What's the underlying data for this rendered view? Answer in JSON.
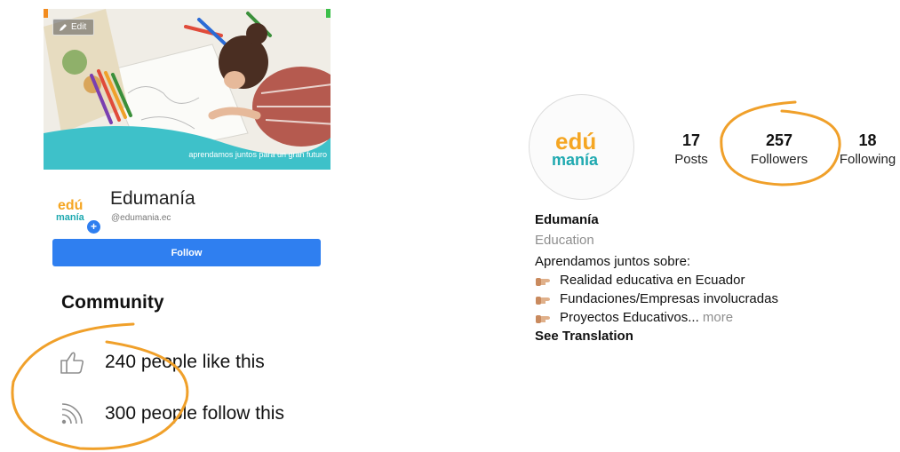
{
  "facebook": {
    "edit_label": "Edit",
    "cover_caption": "aprendamos juntos para un gran futuro",
    "page_name": "Edumanía",
    "handle": "@edumania.ec",
    "follow_label": "Follow",
    "community_title": "Community",
    "likes_text": "240 people like this",
    "follows_text": "300 people follow this"
  },
  "instagram": {
    "stats": [
      {
        "value": "17",
        "label": "Posts"
      },
      {
        "value": "257",
        "label": "Followers"
      },
      {
        "value": "18",
        "label": "Following"
      }
    ],
    "name": "Edumanía",
    "category": "Education",
    "bio_intro": "Aprendamos juntos sobre:",
    "bio_items": [
      "Realidad educativa en Ecuador",
      "Fundaciones/Empresas involucradas",
      "Proyectos Educativos..."
    ],
    "more_label": "more",
    "see_translation": "See Translation"
  },
  "logo": {
    "top": "edú",
    "bottom": "manía"
  },
  "colors": {
    "accent": "#2f7ff0",
    "logo_orange": "#f5a623",
    "logo_teal": "#1fa9b0",
    "annotation": "#f0a02a"
  }
}
